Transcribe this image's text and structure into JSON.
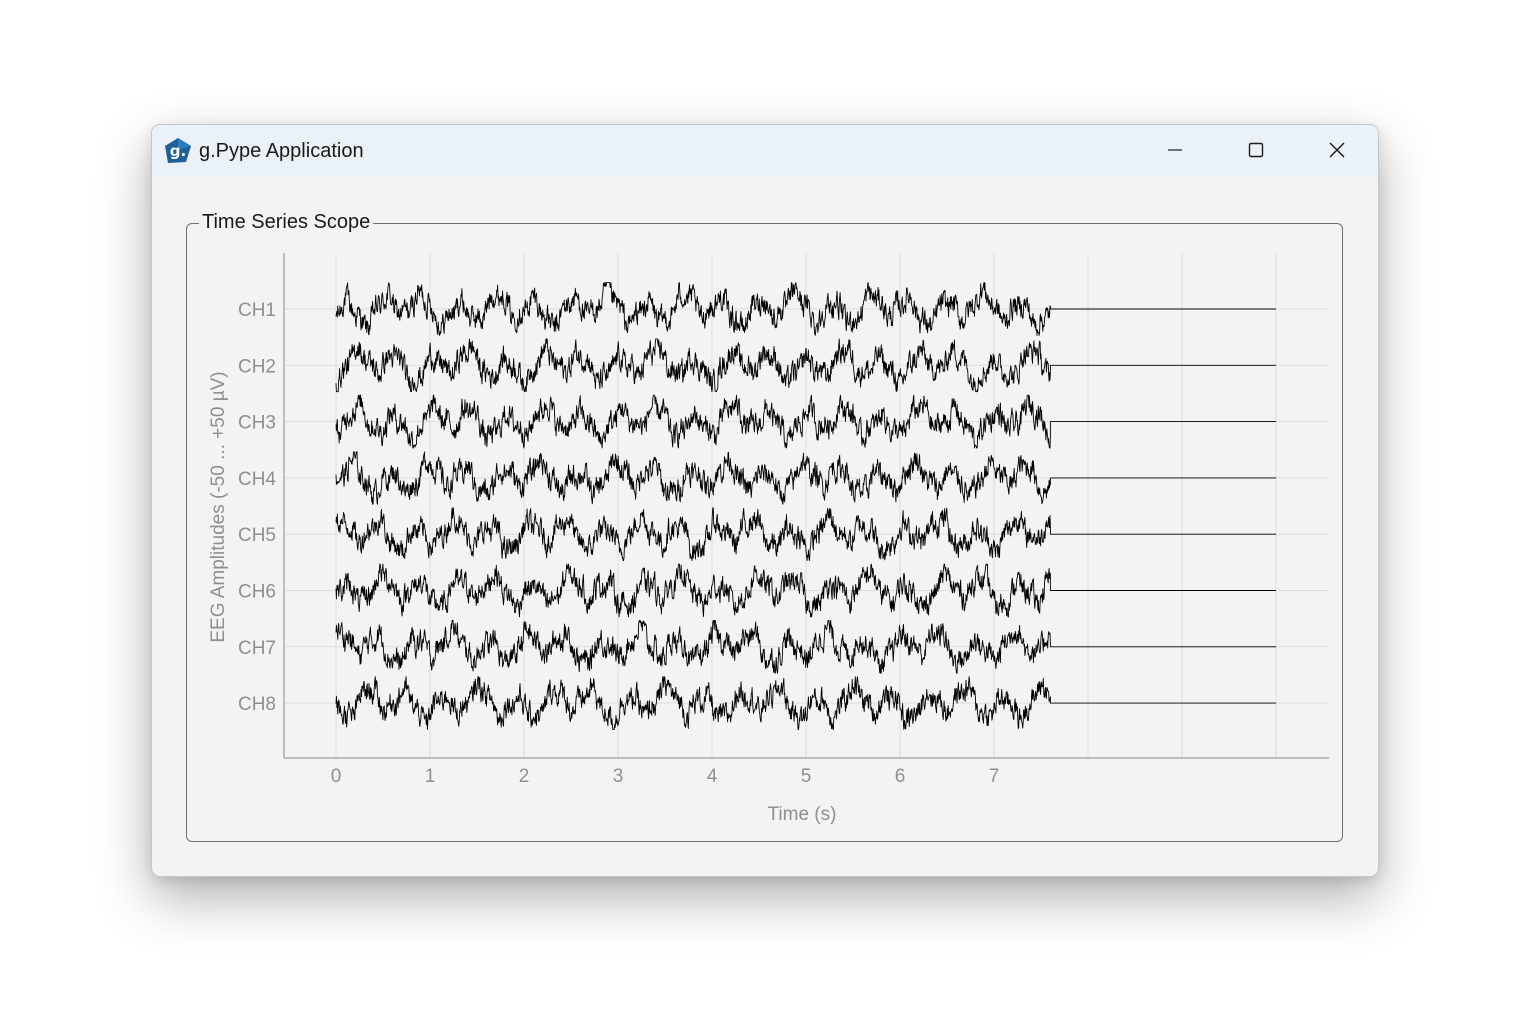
{
  "window": {
    "title": "g.Pype Application",
    "icon": "g-logo-icon",
    "controls": {
      "minimize_icon": "minimize-icon",
      "maximize_icon": "maximize-icon",
      "close_icon": "close-icon"
    }
  },
  "group": {
    "title": "Time Series Scope"
  },
  "chart_data": {
    "type": "line",
    "title": "",
    "xlabel": "Time (s)",
    "ylabel": "EEG Amplitudes (-50 ... +50 µV)",
    "x_ticks": [
      0,
      1,
      2,
      3,
      4,
      5,
      6,
      7
    ],
    "xlim": [
      -0.55,
      10.55
    ],
    "x_gridlines": [
      0,
      1,
      2,
      3,
      4,
      5,
      6,
      7,
      8,
      9,
      10
    ],
    "channel_labels": [
      "CH1",
      "CH2",
      "CH3",
      "CH4",
      "CH5",
      "CH6",
      "CH7",
      "CH8"
    ],
    "signal_end_s": 7.6,
    "buffer_end_s": 10.0,
    "amplitude_range_uV": [
      -50,
      50
    ],
    "line_color": "#000000",
    "grid": true
  }
}
